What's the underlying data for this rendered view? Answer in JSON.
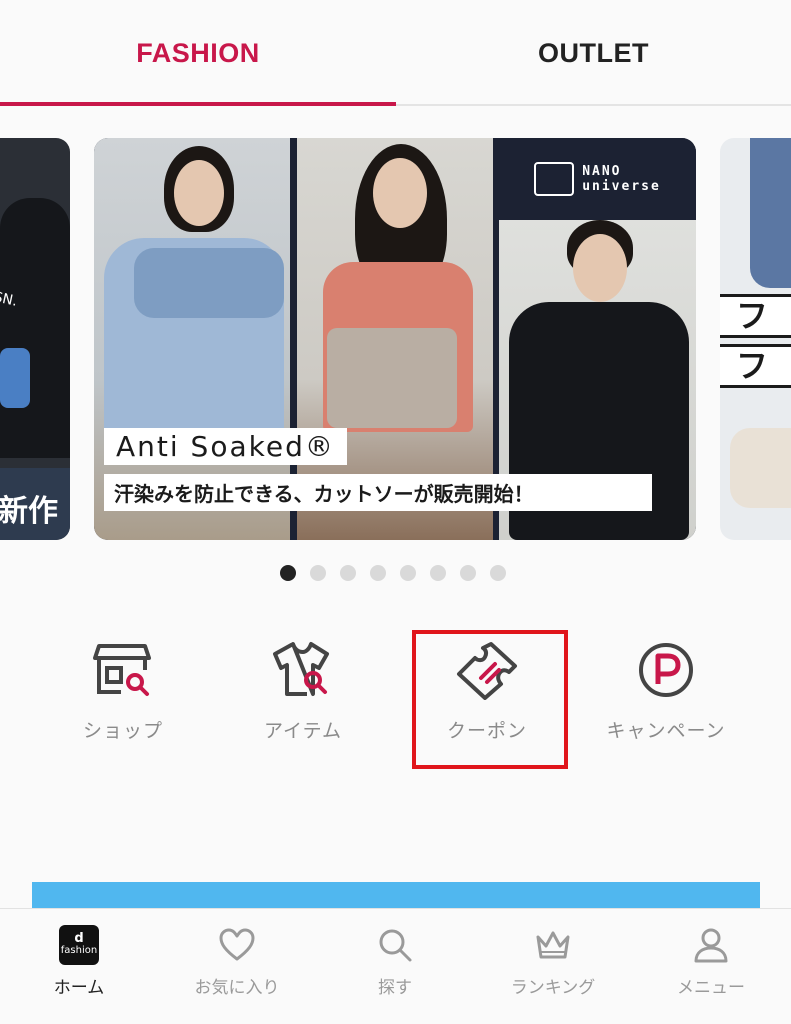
{
  "tabs": [
    {
      "label": "FASHION",
      "active": true
    },
    {
      "label": "OUTLET",
      "active": false
    }
  ],
  "carousel": {
    "main": {
      "brand": [
        "NANO",
        "universe"
      ],
      "headline": "Anti Soaked®",
      "subline": "汗染みを防止できる、カットソーが販売開始！"
    },
    "left_peek": {
      "top_text": "O ASSN.",
      "text": "新作"
    },
    "right_peek": {
      "text_1": "ファ",
      "text_2": "ファ"
    },
    "dots_total": 8,
    "active_index": 0
  },
  "quick_menu": [
    {
      "label": "ショップ",
      "icon": "shop-search-icon"
    },
    {
      "label": "アイテム",
      "icon": "shirt-search-icon"
    },
    {
      "label": "クーポン",
      "icon": "ticket-icon"
    },
    {
      "label": "キャンペーン",
      "icon": "point-p-icon"
    }
  ],
  "bottom_nav": [
    {
      "label": "ホーム",
      "icon": "d-fashion-app-icon",
      "icon_text": [
        "d",
        "fashion"
      ],
      "active": true
    },
    {
      "label": "お気に入り",
      "icon": "heart-icon",
      "active": false
    },
    {
      "label": "探す",
      "icon": "search-icon",
      "active": false
    },
    {
      "label": "ランキング",
      "icon": "crown-icon",
      "active": false
    },
    {
      "label": "メニュー",
      "icon": "user-icon",
      "active": false
    }
  ],
  "colors": {
    "accent": "#c8174a",
    "highlight_box": "#e0151b",
    "banner_blue": "#50b7ef"
  }
}
